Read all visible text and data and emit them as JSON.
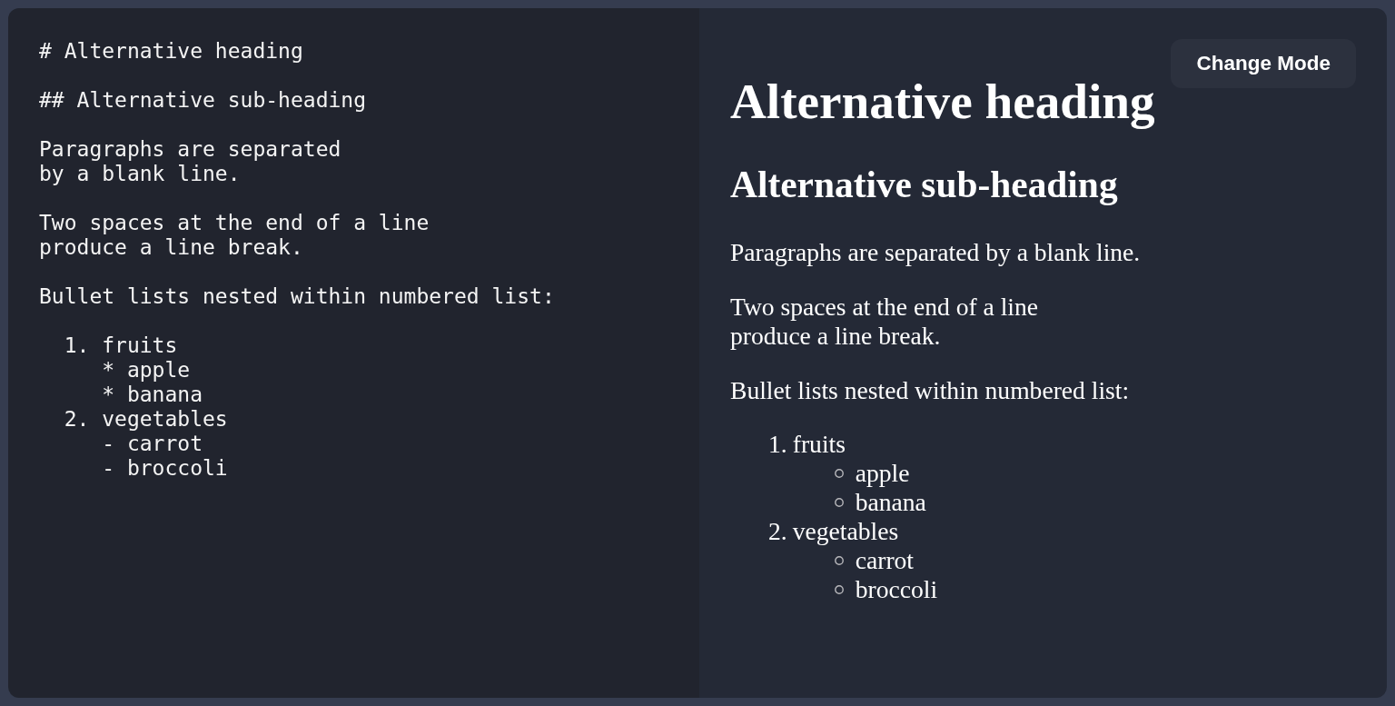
{
  "editor": {
    "blocks": [
      {
        "lines": [
          "# Alternative heading"
        ]
      },
      {
        "lines": [
          "## Alternative sub-heading"
        ]
      },
      {
        "lines": [
          "Paragraphs are separated",
          "by a blank line."
        ]
      },
      {
        "lines": [
          "Two spaces at the end of a line",
          "produce a line break."
        ]
      },
      {
        "lines": [
          "Bullet lists nested within numbered list:"
        ]
      },
      {
        "lines": [
          "  1. fruits",
          "     * apple",
          "     * banana",
          "  2. vegetables",
          "     - carrot",
          "     - broccoli"
        ]
      }
    ]
  },
  "preview": {
    "button": {
      "label": "Change Mode"
    },
    "blocks": [
      {
        "kind": "heading1",
        "text": "Alternative heading"
      },
      {
        "kind": "heading2",
        "text": "Alternative sub-heading"
      },
      {
        "kind": "paragraph",
        "lines": [
          "Paragraphs are separated by a blank line."
        ]
      },
      {
        "kind": "paragraph",
        "lines": [
          "Two spaces at the end of a line",
          "produce a line break."
        ]
      },
      {
        "kind": "paragraph",
        "lines": [
          "Bullet lists nested within numbered list:"
        ]
      },
      {
        "kind": "ordered_list",
        "items": [
          {
            "marker": "1.",
            "text": "fruits",
            "children": [
              {
                "text": "apple"
              },
              {
                "text": "banana"
              }
            ]
          },
          {
            "marker": "2.",
            "text": "vegetables",
            "children": [
              {
                "text": "carrot"
              },
              {
                "text": "broccoli"
              }
            ]
          }
        ]
      }
    ]
  }
}
